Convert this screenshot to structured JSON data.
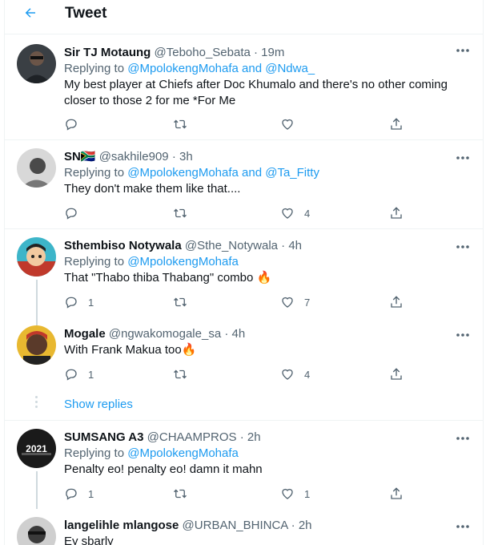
{
  "header": {
    "title": "Tweet"
  },
  "tweets": [
    {
      "name": "Sir TJ Motaung",
      "handle": "@Teboho_Sebata",
      "time": "· 19m",
      "reply_prefix": "Replying to",
      "reply_to": "@MpolokengMohafa and @Ndwa_",
      "text1": "My best player at Chiefs after Doc Khumalo  and there's no other coming",
      "text2": "closer to those 2 for me *For Me",
      "replies": "",
      "likes": ""
    },
    {
      "name": "SN🇿🇦",
      "handle": "@sakhile909",
      "time": "· 3h",
      "reply_prefix": "Replying to",
      "reply_to": "@MpolokengMohafa and @Ta_Fitty",
      "text1": "They don't make them like that....",
      "replies": "",
      "likes": "4"
    },
    {
      "name": "Sthembiso Notywala",
      "handle": "@Sthe_Notywala",
      "time": "· 4h",
      "reply_prefix": "Replying to",
      "reply_to": "@MpolokengMohafa",
      "text1": "That \"Thabo thiba Thabang\" combo 🔥",
      "replies": "1",
      "likes": "7"
    },
    {
      "name": "Mogale",
      "handle": "@ngwakomogale_sa",
      "time": "· 4h",
      "text1": "With Frank Makua too🔥",
      "replies": "1",
      "likes": "4"
    },
    {
      "name": "SUMSANG A3",
      "handle": "@CHAAMPROS",
      "time": "· 2h",
      "reply_prefix": "Replying to",
      "reply_to": "@MpolokengMohafa",
      "text1": "Penalty eo! penalty eo! damn it mahn",
      "replies": "1",
      "likes": "1",
      "avatar_text": "2021"
    },
    {
      "name": "langelihle mlangose",
      "handle": "@URBAN_BHINCA",
      "time": "· 2h",
      "text1": "Ey sbarly"
    }
  ],
  "show_replies": "Show replies",
  "colors": {
    "accent": "#1d9bf0",
    "muted": "#536471",
    "border": "#eff3f4"
  }
}
